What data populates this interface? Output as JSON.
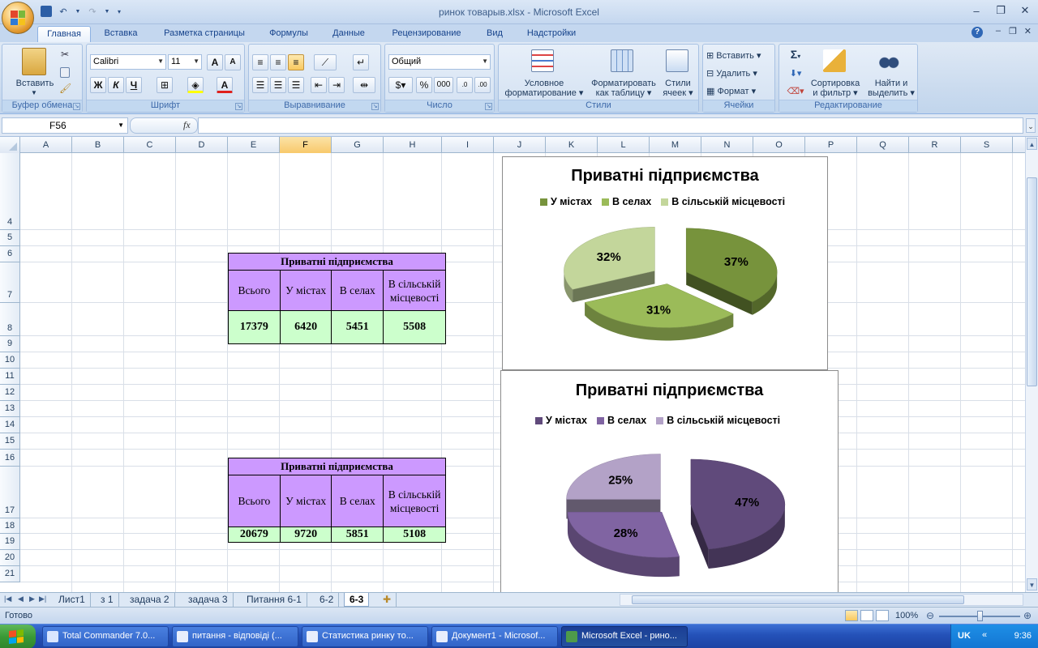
{
  "window": {
    "title": "ринок товарыв.xlsx - Microsoft Excel"
  },
  "ribbon_tabs": [
    "Главная",
    "Вставка",
    "Разметка страницы",
    "Формулы",
    "Данные",
    "Рецензирование",
    "Вид",
    "Надстройки"
  ],
  "ribbon": {
    "clipboard": {
      "label": "Буфер обмена",
      "paste": "Вставить"
    },
    "font": {
      "label": "Шрифт",
      "name": "Calibri",
      "size": "11",
      "bold": "Ж",
      "italic": "К",
      "underline": "Ч"
    },
    "alignment": {
      "label": "Выравнивание"
    },
    "number": {
      "label": "Число",
      "format": "Общий",
      "percent": "%",
      "thousands": "000"
    },
    "styles": {
      "label": "Стили",
      "cond_line1": "Условное",
      "cond_line2": "форматирование",
      "table_line1": "Форматировать",
      "table_line2": "как таблицу",
      "cell_line1": "Стили",
      "cell_line2": "ячеек"
    },
    "cells": {
      "label": "Ячейки",
      "insert": "Вставить",
      "delete": "Удалить",
      "format": "Формат"
    },
    "editing": {
      "label": "Редактирование",
      "sort_line1": "Сортировка",
      "sort_line2": "и фильтр",
      "find_line1": "Найти и",
      "find_line2": "выделить",
      "sigma": "Σ"
    }
  },
  "formula_bar": {
    "cell_ref": "F56",
    "fx": "fx",
    "formula": ""
  },
  "columns": [
    "A",
    "B",
    "C",
    "D",
    "E",
    "F",
    "G",
    "H",
    "I",
    "J",
    "K",
    "L",
    "M",
    "N",
    "O",
    "P",
    "Q",
    "R",
    "S"
  ],
  "selected_column": "F",
  "rows": [
    "4",
    "5",
    "6",
    "7",
    "8",
    "9",
    "10",
    "11",
    "12",
    "13",
    "14",
    "15",
    "16",
    "17",
    "18",
    "19",
    "20",
    "21"
  ],
  "tables": [
    {
      "title": "Приватні підприємства",
      "headers": [
        "Всього",
        "У містах",
        "В селах",
        "В сільській місцевості"
      ],
      "values": [
        "17379",
        "6420",
        "5451",
        "5508"
      ]
    },
    {
      "title": "Приватні підприємства",
      "headers": [
        "Всього",
        "У містах",
        "В селах",
        "В сільській місцевості"
      ],
      "values": [
        "20679",
        "9720",
        "5851",
        "5108"
      ]
    }
  ],
  "chart_data": [
    {
      "type": "pie",
      "title": "Приватні підприємства",
      "categories": [
        "У містах",
        "В селах",
        "В сільській місцевості"
      ],
      "values": [
        37,
        31,
        32
      ],
      "labels": [
        "37%",
        "31%",
        "32%"
      ],
      "colors": [
        "#77933c",
        "#9bbb59",
        "#c3d69b"
      ],
      "legend": "top",
      "exploded": true,
      "style": "3d"
    },
    {
      "type": "pie",
      "title": "Приватні підприємства",
      "categories": [
        "У містах",
        "В селах",
        "В сільській місцевості"
      ],
      "values": [
        47,
        28,
        25
      ],
      "labels": [
        "47%",
        "28%",
        "25%"
      ],
      "colors": [
        "#604a7b",
        "#8064a2",
        "#b3a2c7"
      ],
      "legend": "top",
      "exploded": true,
      "style": "3d"
    }
  ],
  "sheet_tabs": [
    "Лист1",
    "з 1",
    "задача 2",
    "задача 3",
    "Питання 6-1",
    "6-2",
    "6-3"
  ],
  "active_sheet": "6-3",
  "status": {
    "text": "Готово",
    "zoom": "100%"
  },
  "taskbar": {
    "tasks": [
      "Total Commander 7.0...",
      "питання - відповіді (...",
      "Статистика ринку то...",
      "Документ1 - Microsof...",
      "Microsoft Excel - рино..."
    ],
    "language": "UK",
    "clock": "9:36"
  }
}
